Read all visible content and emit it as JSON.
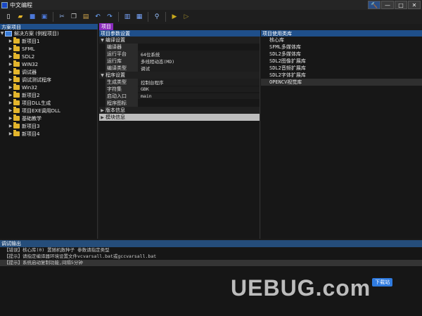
{
  "window": {
    "title": "中文编程",
    "buttons": [
      "🔨",
      "—",
      "□",
      "✕"
    ]
  },
  "toolbar": {
    "icons": [
      "new-file",
      "open-folder",
      "save",
      "save-all",
      "cut",
      "copy",
      "paste",
      "undo",
      "redo",
      "panel-left",
      "panel-split",
      "find",
      "run",
      "step"
    ]
  },
  "left_panel": {
    "header": "方案项目",
    "root": "解决方案 (例程项目)",
    "items": [
      "新项目1",
      "SFML",
      "SDL2",
      "WIN32",
      "调试器",
      "调试测试程序",
      "Win32",
      "新项目2",
      "项目DLL生成",
      "项目EXE调用DLL",
      "基础教学",
      "新项目3",
      "新项目4"
    ]
  },
  "tabs": {
    "active": "项目"
  },
  "middle_panel": {
    "header": "项目参数设置",
    "groups": [
      {
        "label": "编译设置",
        "expanded": true,
        "rows": [
          {
            "key": "编译器",
            "value": ""
          },
          {
            "key": "运行平台",
            "value": "64位系统"
          },
          {
            "key": "运行库",
            "value": "多线程动态(MD)"
          },
          {
            "key": "编译类型",
            "value": "调试"
          }
        ]
      },
      {
        "label": "程序设置",
        "expanded": true,
        "rows": [
          {
            "key": "生成类型",
            "value": "控制台程序"
          },
          {
            "key": "字符集",
            "value": "GBK"
          },
          {
            "key": "启动入口",
            "value": "main"
          },
          {
            "key": "程序图标",
            "value": ""
          }
        ]
      },
      {
        "label": "版本信息",
        "expanded": false,
        "rows": []
      },
      {
        "label": "模块信息",
        "expanded": false,
        "rows": []
      }
    ]
  },
  "right_panel": {
    "header": "项目使用类库",
    "items": [
      "核心库",
      "SFML多媒体库",
      "SDL2多媒体库",
      "SDL2图像扩展库",
      "SDL2音频扩展库",
      "SDL2字体扩展库",
      "OPENCV视觉库"
    ],
    "selected_index": 6
  },
  "output": {
    "header": "调试输出",
    "lines": [
      "【错误】核心库(0) 置随机数种子 参数请指定类型",
      "【提示】请指定编译器环境设置文件vcvarsall.bat或gccvarsall.bat",
      "【提示】系统启动复制功能,间隔5分钟"
    ],
    "highlight_index": 2
  },
  "watermark": {
    "text": "UEBUG.com",
    "badge": "下载站"
  },
  "colors": {
    "accent_header": "#1f4f8a",
    "tab_active": "#8a2bbd",
    "folder": "#e3b52c",
    "background": "#1b1b1b"
  }
}
